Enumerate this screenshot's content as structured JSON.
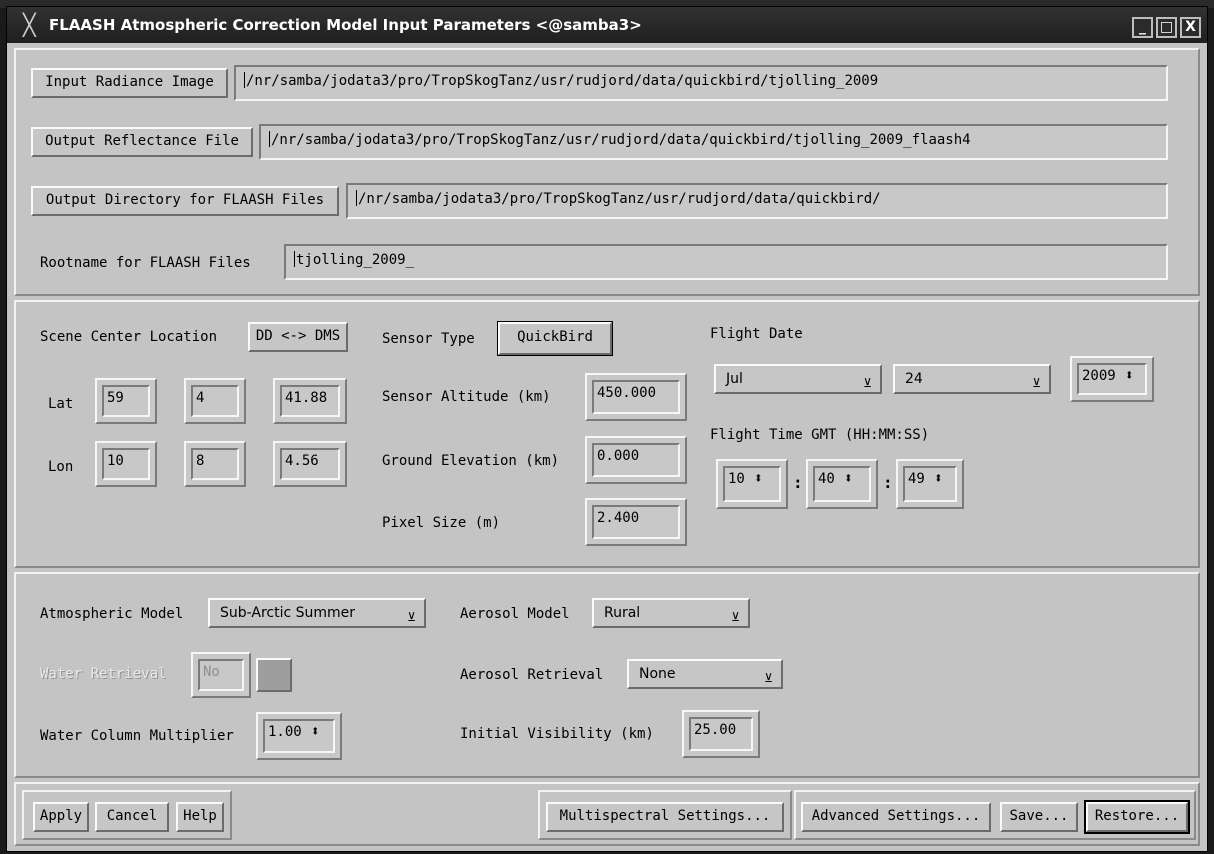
{
  "window": {
    "title": "FLAASH Atmospheric Correction Model Input Parameters <@samba3>",
    "controls": [
      "_",
      "□",
      "X"
    ]
  },
  "files": {
    "input_button": "Input Radiance Image",
    "input_path": "/nr/samba/jodata3/pro/TropSkogTanz/usr/rudjord/data/quickbird/tjolling_2009",
    "output_button": "Output Reflectance File",
    "output_path": "/nr/samba/jodata3/pro/TropSkogTanz/usr/rudjord/data/quickbird/tjolling_2009_flaash4",
    "dir_button": "Output Directory for FLAASH Files",
    "dir_path": "/nr/samba/jodata3/pro/TropSkogTanz/usr/rudjord/data/quickbird/",
    "rootname_label": "Rootname for FLAASH Files",
    "rootname_value": "tjolling_2009_"
  },
  "scene": {
    "location_label": "Scene Center Location",
    "dd_dms_button": "DD <-> DMS",
    "lat_label": "Lat",
    "lat": [
      "59",
      "4",
      "41.88"
    ],
    "lon_label": "Lon",
    "lon": [
      "10",
      "8",
      "4.56"
    ]
  },
  "sensor": {
    "type_label": "Sensor Type",
    "type_value": "QuickBird",
    "altitude_label": "Sensor Altitude (km)",
    "altitude_value": "450.000",
    "elevation_label": "Ground Elevation (km)",
    "elevation_value": "0.000",
    "pixel_label": "Pixel Size (m)",
    "pixel_value": "2.400"
  },
  "flight": {
    "date_label": "Flight Date",
    "month": "Jul",
    "day": "24",
    "year": "2009",
    "time_label": "Flight Time GMT (HH:MM:SS)",
    "hh": "10",
    "mm": "40",
    "ss": "49",
    "colon": ":"
  },
  "atmosphere": {
    "model_label": "Atmospheric Model",
    "model_value": "Sub-Arctic Summer",
    "water_retrieval_label": "Water Retrieval",
    "water_retrieval_value": "No",
    "water_multiplier_label": "Water Column Multiplier",
    "water_multiplier_value": "1.00",
    "aerosol_model_label": "Aerosol Model",
    "aerosol_model_value": "Rural",
    "aerosol_retrieval_label": "Aerosol Retrieval",
    "aerosol_retrieval_value": "None",
    "visibility_label": "Initial Visibility (km)",
    "visibility_value": "25.00"
  },
  "buttons": {
    "apply": "Apply",
    "cancel": "Cancel",
    "help": "Help",
    "multispectral": "Multispectral Settings...",
    "advanced": "Advanced Settings...",
    "save": "Save...",
    "restore": "Restore..."
  }
}
